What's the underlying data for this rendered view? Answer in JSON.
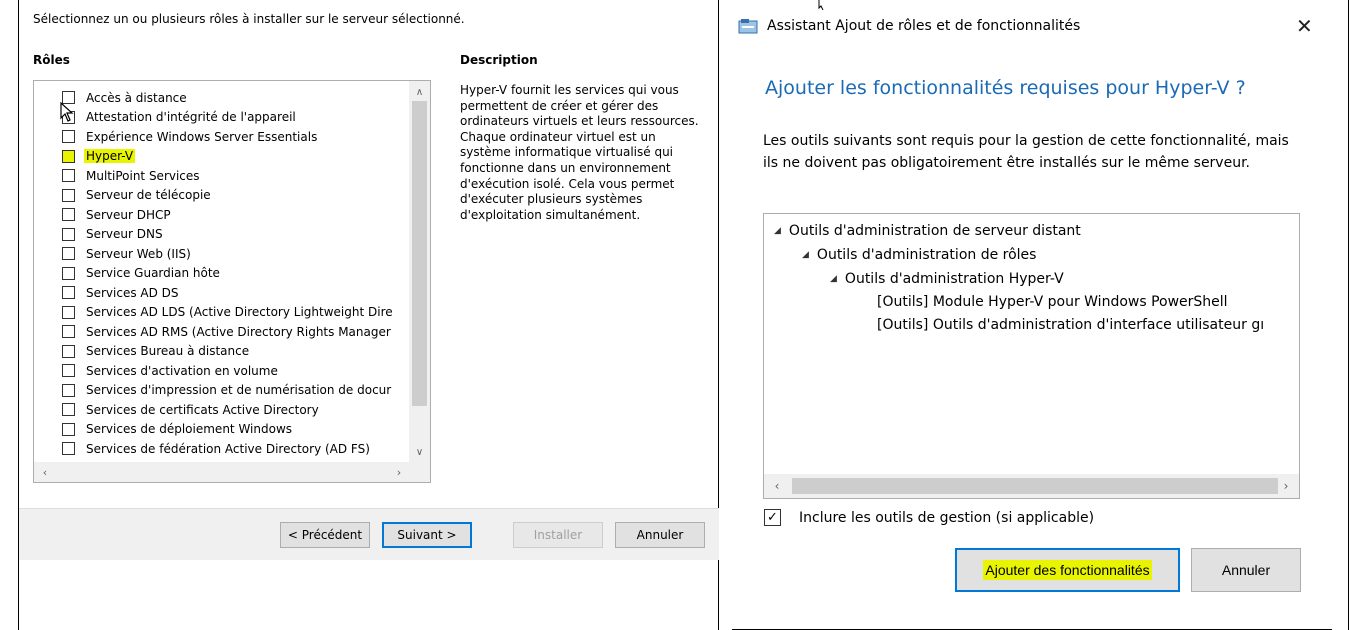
{
  "left_panel": {
    "instruction": "Sélectionnez un ou plusieurs rôles à installer sur le serveur sélectionné.",
    "roles_header": "Rôles",
    "description_header": "Description",
    "roles": [
      {
        "label": "Accès à distance",
        "checked": false
      },
      {
        "label": "Attestation d'intégrité de l'appareil",
        "checked": false
      },
      {
        "label": "Expérience Windows Server Essentials",
        "checked": false
      },
      {
        "label": "Hyper-V",
        "checked": false,
        "highlighted": true
      },
      {
        "label": "MultiPoint Services",
        "checked": false
      },
      {
        "label": "Serveur de télécopie",
        "checked": false
      },
      {
        "label": "Serveur DHCP",
        "checked": false
      },
      {
        "label": "Serveur DNS",
        "checked": false
      },
      {
        "label": "Serveur Web (IIS)",
        "checked": false
      },
      {
        "label": "Service Guardian hôte",
        "checked": false
      },
      {
        "label": "Services AD DS",
        "checked": false
      },
      {
        "label": "Services AD LDS (Active Directory Lightweight Dire",
        "checked": false
      },
      {
        "label": "Services AD RMS (Active Directory Rights Manager",
        "checked": false
      },
      {
        "label": "Services Bureau à distance",
        "checked": false
      },
      {
        "label": "Services d'activation en volume",
        "checked": false
      },
      {
        "label": "Services d'impression et de numérisation de docur",
        "checked": false
      },
      {
        "label": "Services de certificats Active Directory",
        "checked": false
      },
      {
        "label": "Services de déploiement Windows",
        "checked": false
      },
      {
        "label": "Services de fédération Active Directory (AD FS)",
        "checked": false
      }
    ],
    "description": "Hyper-V fournit les services qui vous permettent de créer et gérer des ordinateurs virtuels et leurs ressources. Chaque ordinateur virtuel est un système informatique virtualisé qui fonctionne dans un environnement d'exécution isolé. Cela vous permet d'exécuter plusieurs systèmes d'exploitation simultanément.",
    "buttons": {
      "previous": "< Précédent",
      "next": "Suivant >",
      "install": "Installer",
      "cancel": "Annuler"
    }
  },
  "right_panel": {
    "window_title": "Assistant Ajout de rôles et de fonctionnalités",
    "heading": "Ajouter les fonctionnalités requises pour Hyper-V ?",
    "text": "Les outils suivants sont requis pour la gestion de cette fonctionnalité, mais ils ne doivent pas obligatoirement être installés sur le même serveur.",
    "tree": [
      {
        "label": "Outils d'administration de serveur distant",
        "level": 0,
        "expanded": true
      },
      {
        "label": "Outils d'administration de rôles",
        "level": 1,
        "expanded": true
      },
      {
        "label": "Outils d'administration Hyper-V",
        "level": 2,
        "expanded": true
      },
      {
        "label": "[Outils] Module Hyper-V pour Windows PowerShell",
        "level": 3
      },
      {
        "label": "[Outils] Outils d'administration d'interface utilisateur gı",
        "level": 3
      }
    ],
    "include_tools_label": "Inclure les outils de gestion (si applicable)",
    "include_tools_checked": true,
    "buttons": {
      "add": "Ajouter des fonctionnalités",
      "cancel": "Annuler"
    }
  },
  "colors": {
    "accent": "#0078d7",
    "heading": "#1b6ab5",
    "highlight": "#e8f400"
  }
}
